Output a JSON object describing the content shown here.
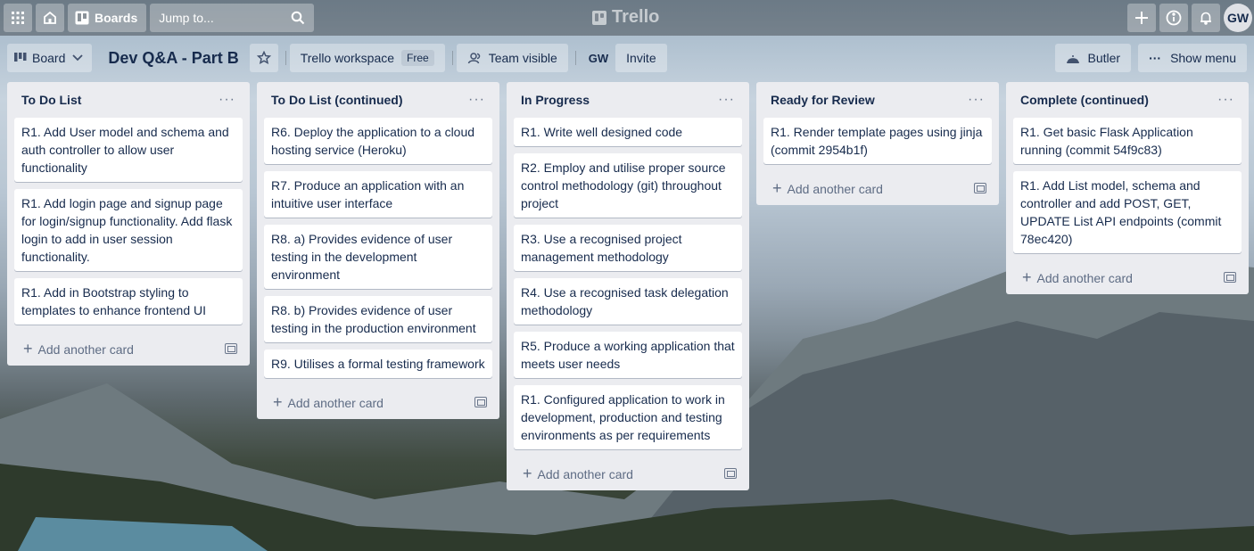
{
  "nav": {
    "boards_label": "Boards",
    "search_placeholder": "Jump to...",
    "logo_text": "Trello",
    "avatar": "GW"
  },
  "header": {
    "view_label": "Board",
    "title": "Dev Q&A - Part B",
    "workspace_label": "Trello workspace",
    "workspace_badge": "Free",
    "visibility_label": "Team visible",
    "member_initials": "GW",
    "invite_label": "Invite",
    "butler_label": "Butler",
    "menu_label": "Show menu"
  },
  "add_card_label": "Add another card",
  "lists": [
    {
      "title": "To Do List",
      "cards": [
        "R1. Add User model and schema and auth controller to allow user functionality",
        "R1. Add login page and signup page for login/signup functionality. Add flask login to add in user session functionality.",
        "R1. Add in Bootstrap styling to templates to enhance frontend UI"
      ]
    },
    {
      "title": "To Do List (continued)",
      "cards": [
        "R6. Deploy the application to a cloud hosting service (Heroku)",
        "R7. Produce an application with an intuitive user interface",
        "R8. a) Provides evidence of user testing in the development environment",
        "R8. b) Provides evidence of user testing in the production environment",
        "R9. Utilises a formal testing framework"
      ]
    },
    {
      "title": "In Progress",
      "cards": [
        "R1. Write well designed code",
        "R2. Employ and utilise proper source control methodology (git) throughout project",
        "R3. Use a recognised project management methodology",
        "R4. Use a recognised task delegation methodology",
        "R5. Produce a working application that meets user needs",
        "R1. Configured application to work in development, production and testing environments as per requirements"
      ]
    },
    {
      "title": "Ready for Review",
      "cards": [
        "R1. Render template pages using jinja (commit 2954b1f)"
      ]
    },
    {
      "title": "Complete (continued)",
      "cards": [
        "R1. Get basic Flask Application running (commit 54f9c83)",
        "R1. Add List model, schema and controller and add POST, GET, UPDATE List API endpoints (commit 78ec420)"
      ]
    }
  ]
}
